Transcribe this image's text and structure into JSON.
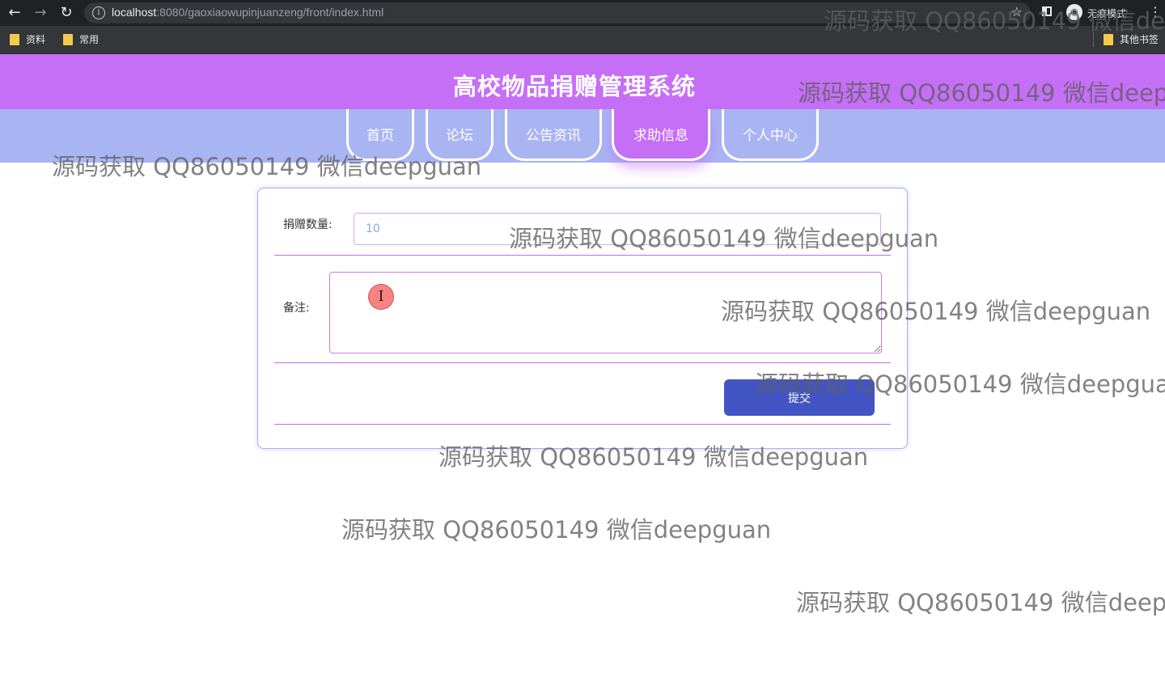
{
  "browser": {
    "url_host": "localhost",
    "url_rest": ":8080/gaoxiaowupinjuanzeng/front/index.html",
    "mode_label": "无痕模式",
    "bookmarks": [
      "资料",
      "常用"
    ],
    "other_bookmarks": "其他书签"
  },
  "site": {
    "title": "高校物品捐赠管理系统",
    "nav": [
      {
        "label": "首页",
        "active": false
      },
      {
        "label": "论坛",
        "active": false
      },
      {
        "label": "公告资讯",
        "active": false
      },
      {
        "label": "求助信息",
        "active": true
      },
      {
        "label": "个人中心",
        "active": false
      }
    ]
  },
  "form": {
    "quantity_label": "捐赠数量:",
    "quantity_value": "10",
    "note_label": "备注:",
    "note_value": "",
    "submit_label": "提交"
  },
  "watermark": {
    "text": "源码获取 QQ86050149 微信deepguan"
  },
  "colors": {
    "header": "#c56ff7",
    "nav_strip": "#a9b4f3",
    "submit": "#4355c4",
    "row_line": "#c26ee0"
  }
}
